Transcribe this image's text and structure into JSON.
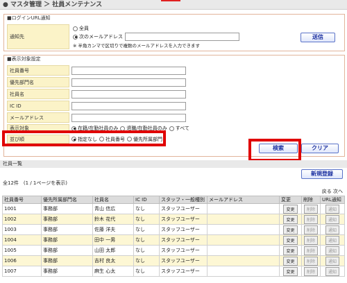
{
  "breadcrumb": "● マスタ管理 ＞ 社員メンテナンス",
  "login": {
    "section_title": "■ログインURL通知",
    "label": "通知先",
    "opt_all": "全員",
    "opt_email": "次のメールアドレス",
    "note": "※ 半角カンマで区切りで複数のメールアドレスを入力できます",
    "send": "送信"
  },
  "filter": {
    "section_title": "■表示対象設定",
    "fields": [
      "社員番号",
      "優先部門名",
      "社員名",
      "IC ID",
      "メールアドレス"
    ],
    "target_label": "表示対象",
    "target_opts": [
      "在籍/在勤社員のみ",
      "退職/在勤社員のみ",
      "すべて"
    ],
    "order_label": "並び順",
    "order_opts": [
      "指定なし",
      "社員番号",
      "優先所属部門"
    ],
    "search": "検索",
    "clear": "クリア"
  },
  "list": {
    "title": "社員一覧",
    "new": "新規登録",
    "count": "全12件　(1 / 1ページを表示)",
    "pager": "戻る 次へ",
    "headers": [
      "社員番号",
      "優先所属部門名",
      "社員名",
      "IC ID",
      "スタッフ・一般種別",
      "メールアドレス",
      "変更",
      "削除",
      "URL通知"
    ],
    "btn_edit": "変更",
    "btn_delete": "削除",
    "btn_notify": "通知",
    "rows": [
      {
        "id": "1001",
        "dept": "事務部",
        "name": "青山 信広",
        "ic": "なし",
        "type": "スタッフユーザー",
        "mail": ""
      },
      {
        "id": "1002",
        "dept": "事務部",
        "name": "鈴木 花代",
        "ic": "なし",
        "type": "スタッフユーザー",
        "mail": ""
      },
      {
        "id": "1003",
        "dept": "事務部",
        "name": "佐藤 洋夫",
        "ic": "なし",
        "type": "スタッフユーザー",
        "mail": ""
      },
      {
        "id": "1004",
        "dept": "事務部",
        "name": "田中 一男",
        "ic": "なし",
        "type": "スタッフユーザー",
        "mail": ""
      },
      {
        "id": "1005",
        "dept": "事務部",
        "name": "山田 太郎",
        "ic": "なし",
        "type": "スタッフユーザー",
        "mail": ""
      },
      {
        "id": "1006",
        "dept": "事務部",
        "name": "吉村 良太",
        "ic": "なし",
        "type": "スタッフユーザー",
        "mail": ""
      },
      {
        "id": "1007",
        "dept": "事務部",
        "name": "麻生 心太",
        "ic": "なし",
        "type": "スタッフユーザー",
        "mail": ""
      }
    ]
  }
}
